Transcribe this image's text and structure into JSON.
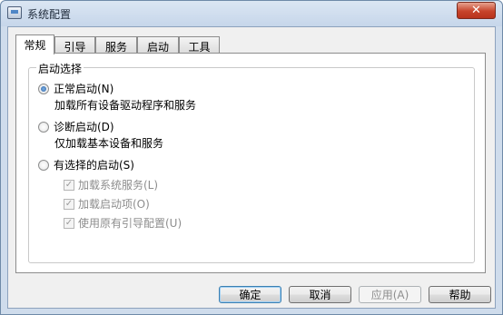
{
  "window": {
    "title": "系统配置",
    "close_glyph": "✕"
  },
  "tabs": [
    {
      "label": "常规",
      "active": true
    },
    {
      "label": "引导",
      "active": false
    },
    {
      "label": "服务",
      "active": false
    },
    {
      "label": "启动",
      "active": false
    },
    {
      "label": "工具",
      "active": false
    }
  ],
  "startup_group": {
    "label": "启动选择",
    "options": [
      {
        "label": "正常启动(N)",
        "description": "加载所有设备驱动程序和服务",
        "checked": true
      },
      {
        "label": "诊断启动(D)",
        "description": "仅加载基本设备和服务",
        "checked": false
      },
      {
        "label": "有选择的启动(S)",
        "checked": false
      }
    ],
    "selective_items": [
      {
        "label": "加载系统服务(L)",
        "checked": true,
        "enabled": false
      },
      {
        "label": "加载启动项(O)",
        "checked": true,
        "enabled": false
      },
      {
        "label": "使用原有引导配置(U)",
        "checked": true,
        "enabled": false
      }
    ]
  },
  "buttons": {
    "ok": "确定",
    "cancel": "取消",
    "apply": "应用(A)",
    "help": "帮助"
  }
}
